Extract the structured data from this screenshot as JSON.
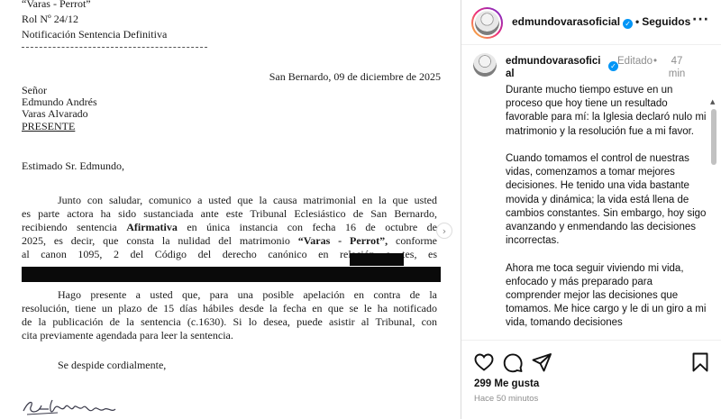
{
  "document": {
    "case_name": "“Varas - Perrot”",
    "rol": "Rol Nº 24/12",
    "notice_type": "Notificación Sentencia Definitiva",
    "place_date": "San Bernardo, 09 de diciembre de 2025",
    "salutation_lines": [
      "Señor",
      "Edmundo Andrés",
      "Varas Alvarado",
      "PRESENTE"
    ],
    "greeting": "Estimado Sr. Edmundo,",
    "paragraph1_lines": [
      "Junto con saludar, comunico a usted que la causa matrimonial en la que usted",
      "es parte actora ha sido sustanciada ante este Tribunal Eclesiástico de San Bernardo,",
      "recibiendo sentencia Afirmativa en única instancia con fecha 16 de octubre de",
      "2025, es decir, que consta la nulidad del matrimonio “Varas - Perrot”, conforme",
      "al canon 1095, 2 del Código del derecho canónico en relación a              tes, es"
    ],
    "paragraph2_lines": [
      "Hago presente a usted que, para una posible apelación en contra de la",
      "resolución, tiene un plazo de 15 días hábiles desde la fecha en que se le ha notificado",
      "de la publicación de la sentencia (c.1630). Si lo desea, puede asistir al Tribunal, con",
      "cita previamente agendada para leer la sentencia."
    ],
    "closing": "Se despide cordialmente,"
  },
  "post": {
    "username": "edmundovarasoficial",
    "follow_status": "Seguidos",
    "caption_username": "edmundovarasoficial",
    "edited_label": "Editado",
    "time_label": "47 min",
    "caption_paragraphs": [
      "Durante mucho tiempo estuve en un proceso que hoy tiene un resultado favorable para mí: la Iglesia declaró nulo mi matrimonio y la resolución fue a mi favor.",
      "Cuando tomamos el control de nuestras vidas, comenzamos a tomar mejores decisiones. He tenido una vida bastante movida y dinámica; la vida está llena de cambios constantes. Sin embargo, hoy sigo avanzando y enmendando las decisiones incorrectas.",
      "Ahora me toca seguir viviendo mi vida, enfocado y más preparado para comprender mejor las decisiones que tomamos. Me hice cargo y le di un giro a mi vida, tomando decisiones"
    ],
    "likes": "299 Me gusta",
    "posted_ago": "Hace 50 minutos"
  },
  "icons": {
    "verified": "verified-badge-icon",
    "more": "more-options-icon",
    "like": "heart-icon",
    "comment": "comment-icon",
    "share": "send-icon",
    "save": "bookmark-icon"
  },
  "colors": {
    "verified_blue": "#0095f6",
    "muted_text": "#8e8e8e",
    "border": "#dbdbdb"
  }
}
